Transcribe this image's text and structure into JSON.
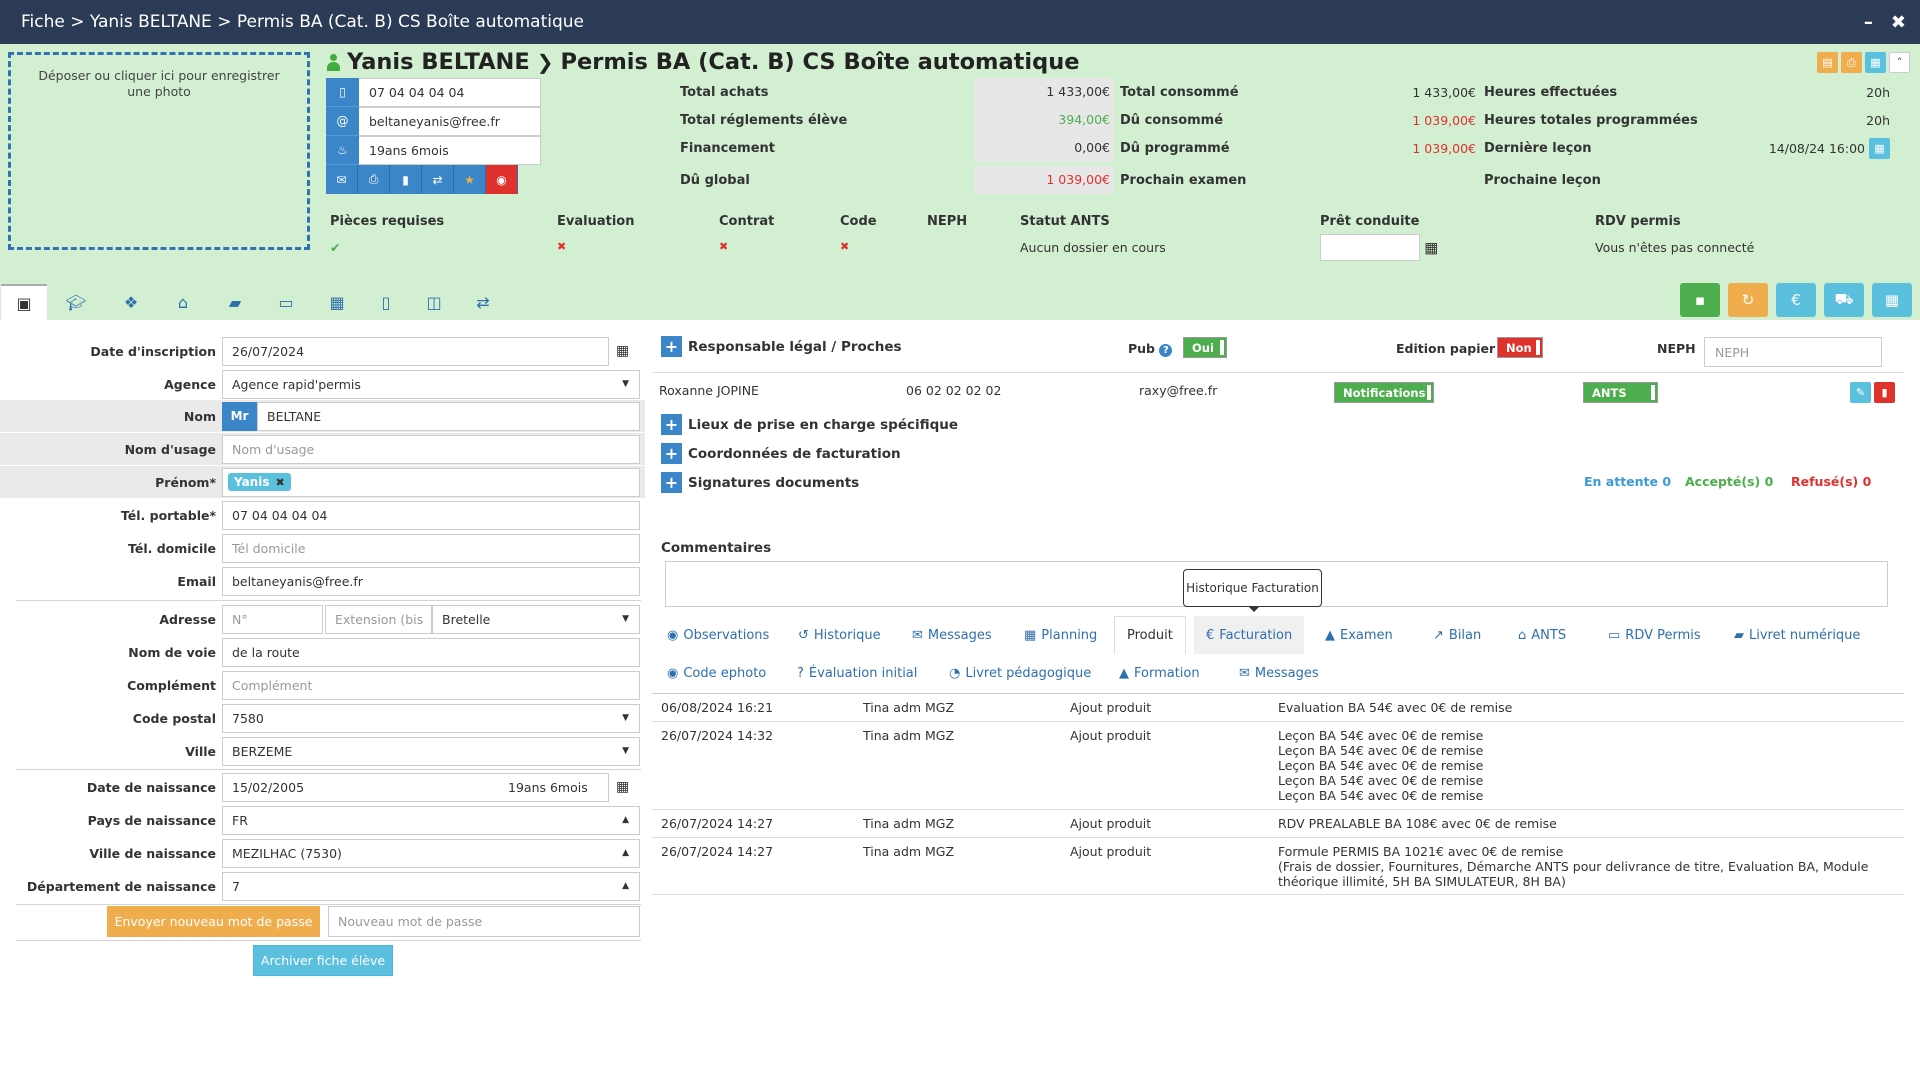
{
  "titlebar": {
    "path": "Fiche > Yanis BELTANE > Permis BA (Cat. B) CS Boîte automatique",
    "minimize": "–",
    "close": "✖"
  },
  "photo": {
    "text": "Déposer ou cliquer ici pour enregistrer une photo"
  },
  "student": {
    "name": "Yanis BELTANE",
    "formation": "Permis BA (Cat. B) CS Boîte automatique"
  },
  "contact": {
    "phone": "07 04 04 04 04",
    "email": "beltaneyanis@free.fr",
    "age": "19ans 6mois"
  },
  "stats": {
    "total_achats_label": "Total achats",
    "total_achats": "1 433,00€",
    "total_reglements_label": "Total réglements élève",
    "total_reglements": "394,00€",
    "financement_label": "Financement",
    "financement": "0,00€",
    "du_global_label": "Dû global",
    "du_global": "1 039,00€",
    "total_consomme_label": "Total consommé",
    "total_consomme": "1 433,00€",
    "du_consomme_label": "Dû consommé",
    "du_consomme": "1 039,00€",
    "du_programme_label": "Dû programmé",
    "du_programme": "1 039,00€",
    "prochain_examen_label": "Prochain examen",
    "heures_effectuees_label": "Heures effectuées",
    "heures_effectuees": "20h",
    "heures_programmees_label": "Heures totales programmées",
    "heures_programmees": "20h",
    "derniere_lecon_label": "Dernière leçon",
    "derniere_lecon": "14/08/24 16:00",
    "prochaine_lecon_label": "Prochaine leçon"
  },
  "status": {
    "pieces_label": "Pièces requises",
    "evaluation_label": "Evaluation",
    "contrat_label": "Contrat",
    "code_label": "Code",
    "neph_label": "NEPH",
    "ants_label": "Statut ANTS",
    "ants_value": "Aucun dossier en cours",
    "pret_label": "Prêt conduite",
    "rdv_label": "RDV permis",
    "rdv_value": "Vous n'êtes pas connecté",
    "check": "✔",
    "cross": "✖"
  },
  "form": {
    "date_inscription_label": "Date d'inscription",
    "date_inscription": "26/07/2024",
    "agence_label": "Agence",
    "agence": "Agence rapid'permis",
    "nom_label": "Nom",
    "civilite": "Mr",
    "nom": "BELTANE",
    "nom_usage_label": "Nom d'usage",
    "nom_usage_ph": "Nom d'usage",
    "prenom_label": "Prénom*",
    "prenom": "Yanis",
    "chip_x": "✖",
    "tel_portable_label": "Tél. portable*",
    "tel_portable": "07 04 04 04 04",
    "tel_domicile_label": "Tél. domicile",
    "tel_domicile_ph": "Tél domicile",
    "email_label": "Email",
    "email": "beltaneyanis@free.fr",
    "adresse_label": "Adresse",
    "numero_ph": "N°",
    "extension_ph": "Extension (bis",
    "voie_type": "Bretelle",
    "nom_voie_label": "Nom de voie",
    "nom_voie": "de la route",
    "complement_label": "Complément",
    "complement_ph": "Complément",
    "code_postal_label": "Code postal",
    "code_postal": "7580",
    "ville_label": "Ville",
    "ville": "BERZEME",
    "date_naissance_label": "Date de naissance",
    "date_naissance": "15/02/2005",
    "age": "19ans 6mois",
    "pays_naissance_label": "Pays de naissance",
    "pays_naissance": "FR",
    "ville_naissance_label": "Ville de naissance",
    "ville_naissance": "MEZILHAC (7530)",
    "dept_naissance_label": "Département de naissance",
    "dept_naissance": "7",
    "send_password": "Envoyer nouveau mot de passe",
    "new_password_ph": "Nouveau mot de passe",
    "archive": "Archiver fiche élève"
  },
  "right": {
    "responsable": "Responsable légal / Proches",
    "pub_label": "Pub",
    "pub_value": "Oui",
    "edition_label": "Edition papier",
    "edition_value": "Non",
    "neph_label": "NEPH",
    "neph_ph": "NEPH",
    "contact_name": "Roxanne JOPINE",
    "contact_phone": "06 02 02 02 02",
    "contact_email": "raxy@free.fr",
    "notif": "Notifications",
    "ants": "ANTS",
    "lieux": "Lieux de prise en charge spécifique",
    "coord": "Coordonnées de facturation",
    "signatures": "Signatures documents",
    "attente": "En attente 0",
    "accepte": "Accepté(s) 0",
    "refuse": "Refusé(s) 0",
    "commentaires": "Commentaires",
    "tooltip": "Historique Facturation"
  },
  "tabs": {
    "observations": "Observations",
    "historique": "Historique",
    "messages": "Messages",
    "planning": "Planning",
    "produit": "Produit",
    "facturation": "Facturation",
    "examen": "Examen",
    "bilan": "Bilan",
    "ants": "ANTS",
    "rdv": "RDV Permis",
    "livret": "Livret numérique",
    "code_ephoto": "Code ephoto",
    "evaluation": "Évaluation initial",
    "livret_peda": "Livret pédagogique",
    "formation": "Formation",
    "messages2": "Messages"
  },
  "history": [
    {
      "date": "06/08/2024 16:21",
      "user": "Tina adm MGZ",
      "action": "Ajout produit",
      "detail": [
        "Evaluation BA 54€ avec 0€ de remise"
      ]
    },
    {
      "date": "26/07/2024 14:32",
      "user": "Tina adm MGZ",
      "action": "Ajout produit",
      "detail": [
        "Leçon BA 54€ avec 0€ de remise",
        "Leçon BA 54€ avec 0€ de remise",
        "Leçon BA 54€ avec 0€ de remise",
        "Leçon BA 54€ avec 0€ de remise",
        "Leçon BA 54€ avec 0€ de remise"
      ]
    },
    {
      "date": "26/07/2024 14:27",
      "user": "Tina adm MGZ",
      "action": "Ajout produit",
      "detail": [
        "RDV PREALABLE BA 108€ avec 0€ de remise"
      ]
    },
    {
      "date": "26/07/2024 14:27",
      "user": "Tina adm MGZ",
      "action": "Ajout produit",
      "detail": [
        "Formule PERMIS BA 1021€ avec 0€ de remise",
        "(Frais de dossier, Fournitures, Démarche ANTS pour delivrance de titre, Evaluation BA, Module",
        "théorique illimité, 5H BA SIMULATEUR, 8H BA)"
      ]
    }
  ],
  "colors": {
    "titlebar": "#2b3a55",
    "header": "#d3efd1",
    "accent": "#3a86c8",
    "red": "#e0322d",
    "green": "#4cae4c",
    "orange": "#f0ad4e",
    "cyan": "#5bc0de"
  }
}
